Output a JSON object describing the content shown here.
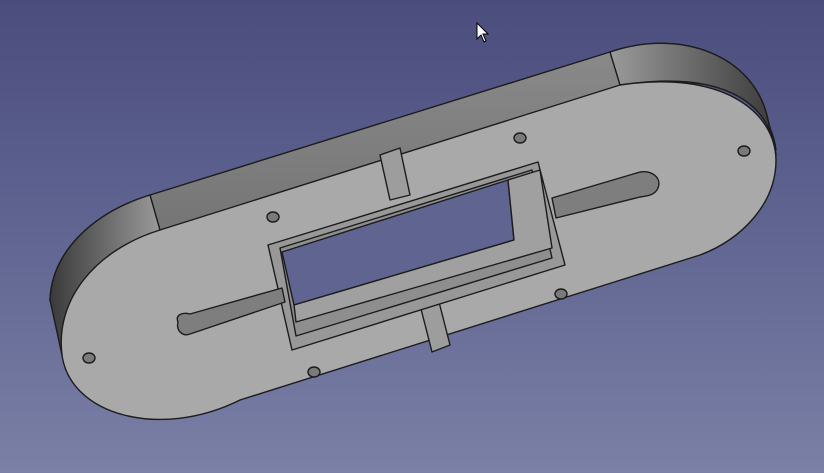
{
  "app": {
    "window_title": "",
    "view": "3D viewport"
  },
  "scene": {
    "background_top": "#4b4d7d",
    "background_bottom": "#7b80a6",
    "model": {
      "description_visible_text": "",
      "face_color": "#a9a9a9",
      "side_color": "#7d7d7d",
      "edge_color": "#1c1c1c"
    }
  },
  "cursor": {
    "type": "arrow-pointer"
  }
}
